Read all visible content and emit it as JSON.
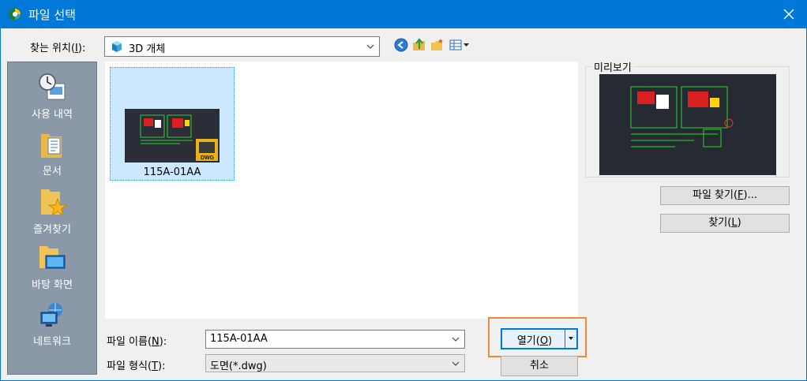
{
  "window": {
    "title": "파일 선택",
    "app_icon": "app-logo-icon",
    "close_icon": "close-icon"
  },
  "look_in": {
    "label_prefix": "찾는 위치(",
    "mnemonic": "I",
    "label_suffix": "):",
    "value": "3D 개체",
    "icon": "3d-objects-folder-icon"
  },
  "toolbar": {
    "icons": [
      "back-icon",
      "up-folder-icon",
      "new-folder-icon",
      "views-menu-icon"
    ]
  },
  "places": [
    {
      "label": "사용 내역",
      "icon": "history-icon"
    },
    {
      "label": "문서",
      "icon": "documents-icon"
    },
    {
      "label": "즐겨찾기",
      "icon": "favorites-icon"
    },
    {
      "label": "바탕 화면",
      "icon": "desktop-icon"
    },
    {
      "label": "네트워크",
      "icon": "network-icon"
    }
  ],
  "files": [
    {
      "name": "115A-01AA",
      "badge": "DWG"
    }
  ],
  "preview": {
    "label": "미리보기"
  },
  "find_file": {
    "prefix": "파일 찾기(",
    "mnemonic": "F",
    "suffix": ")..."
  },
  "find": {
    "prefix": "찾기(",
    "mnemonic": "L",
    "suffix": ")"
  },
  "file_name": {
    "prefix": "파일 이름(",
    "mnemonic": "N",
    "suffix": "):",
    "value": "115A-01AA"
  },
  "file_type": {
    "prefix": "파일 형식(",
    "mnemonic": "T",
    "suffix": "):",
    "value": "도면(*.dwg)"
  },
  "open_button": {
    "prefix": "열기(",
    "mnemonic": "O",
    "suffix": ")"
  },
  "cancel_button": {
    "label": "취소"
  },
  "colors": {
    "titlebar": "#0078d7",
    "places_bg": "#8a98a7",
    "selection": "#cce8ff",
    "highlight": "#f0883a"
  }
}
